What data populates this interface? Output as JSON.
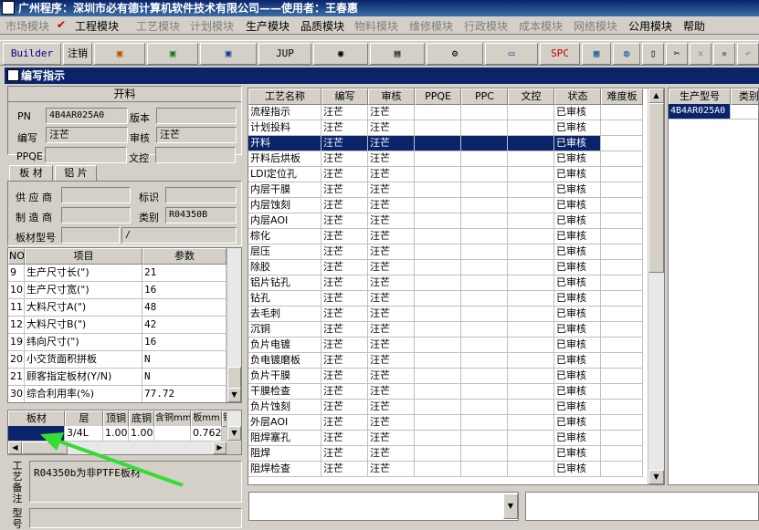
{
  "app_title": "广州程序：深圳市必有德计算机软件技术有限公司——使用者：王春惠",
  "menu": [
    {
      "label": "市场模块",
      "enabled": false
    },
    {
      "label": "工程模块",
      "enabled": true,
      "checked": true
    },
    {
      "label": "工艺模块",
      "enabled": false
    },
    {
      "label": "计划模块",
      "enabled": false
    },
    {
      "label": "生产模块",
      "enabled": true
    },
    {
      "label": "品质模块",
      "enabled": true
    },
    {
      "label": "物料模块",
      "enabled": false
    },
    {
      "label": "维修模块",
      "enabled": false
    },
    {
      "label": "行政模块",
      "enabled": false
    },
    {
      "label": "成本模块",
      "enabled": false
    },
    {
      "label": "网络模块",
      "enabled": false
    },
    {
      "label": "公用模块",
      "enabled": true
    },
    {
      "label": "帮助",
      "enabled": true
    }
  ],
  "toolbar": {
    "builder": "Builder",
    "logout": "注销",
    "jup": "JUP",
    "spc": "SPC"
  },
  "window_title": "编写指示",
  "process": {
    "title": "开料",
    "pn_label": "PN",
    "pn_value": "4B4AR025A0",
    "version_label": "版本",
    "version_value": "",
    "author_label": "编写",
    "author_value": "汪芒",
    "review_label": "审核",
    "review_value": "汪芒",
    "ppqe_label": "PPQE",
    "ppqe_value": "",
    "ctrl_label": "文控",
    "ctrl_value": ""
  },
  "tabs": [
    "板 材",
    "铝 片"
  ],
  "material": {
    "supplier_label": "供 应 商",
    "supplier_value": "",
    "mark_label": "标识",
    "mark_value": "",
    "maker_label": "制 造 商",
    "maker_value": "",
    "type_label": "类别",
    "type_value": "R04350B",
    "model_label": "板材型号",
    "model_value": "",
    "model_value2": "/"
  },
  "param_table": {
    "headers": [
      "NO",
      "项目",
      "参数"
    ],
    "rows": [
      [
        "9",
        "生产尺寸长(\")",
        "21"
      ],
      [
        "10",
        "生产尺寸宽(\")",
        "16"
      ],
      [
        "11",
        "大料尺寸A(\")",
        "48"
      ],
      [
        "12",
        "大料尺寸B(\")",
        "42"
      ],
      [
        "19",
        "纬向尺寸(\")",
        "16"
      ],
      [
        "20",
        "小交货面积拼板",
        "N"
      ],
      [
        "21",
        "顾客指定板材(Y/N)",
        "N"
      ],
      [
        "30",
        "综合利用率(%)",
        "77.72"
      ]
    ]
  },
  "board_table": {
    "headers": [
      "板材",
      "层",
      "顶铜",
      "底铜",
      "含铜mm",
      "板mm",
      "铜"
    ],
    "rows": [
      [
        "",
        "3/4L",
        "1.00",
        "1.00",
        "",
        "0.762",
        ""
      ]
    ]
  },
  "remark_label": "工艺备注",
  "remark_text": "R04350b为非PTFE板材",
  "model_label2": "型号",
  "process_table": {
    "headers": [
      "工艺名称",
      "编写",
      "审核",
      "PPQE",
      "PPC",
      "文控",
      "状态",
      "难度板"
    ],
    "selected_index": 2,
    "rows": [
      [
        "流程指示",
        "汪芒",
        "汪芒",
        "",
        "",
        "",
        "已审核",
        ""
      ],
      [
        "计划投料",
        "汪芒",
        "汪芒",
        "",
        "",
        "",
        "已审核",
        ""
      ],
      [
        "开料",
        "汪芒",
        "汪芒",
        "",
        "",
        "",
        "已审核",
        ""
      ],
      [
        "开料后烘板",
        "汪芒",
        "汪芒",
        "",
        "",
        "",
        "已审核",
        ""
      ],
      [
        "LDI定位孔",
        "汪芒",
        "汪芒",
        "",
        "",
        "",
        "已审核",
        ""
      ],
      [
        "内层干膜",
        "汪芒",
        "汪芒",
        "",
        "",
        "",
        "已审核",
        ""
      ],
      [
        "内层蚀刻",
        "汪芒",
        "汪芒",
        "",
        "",
        "",
        "已审核",
        ""
      ],
      [
        "内层AOI",
        "汪芒",
        "汪芒",
        "",
        "",
        "",
        "已审核",
        ""
      ],
      [
        "棕化",
        "汪芒",
        "汪芒",
        "",
        "",
        "",
        "已审核",
        ""
      ],
      [
        "层压",
        "汪芒",
        "汪芒",
        "",
        "",
        "",
        "已审核",
        ""
      ],
      [
        "除胶",
        "汪芒",
        "汪芒",
        "",
        "",
        "",
        "已审核",
        ""
      ],
      [
        "铝片钻孔",
        "汪芒",
        "汪芒",
        "",
        "",
        "",
        "已审核",
        ""
      ],
      [
        "钻孔",
        "汪芒",
        "汪芒",
        "",
        "",
        "",
        "已审核",
        ""
      ],
      [
        "去毛刺",
        "汪芒",
        "汪芒",
        "",
        "",
        "",
        "已审核",
        ""
      ],
      [
        "沉铜",
        "汪芒",
        "汪芒",
        "",
        "",
        "",
        "已审核",
        ""
      ],
      [
        "负片电镀",
        "汪芒",
        "汪芒",
        "",
        "",
        "",
        "已审核",
        ""
      ],
      [
        "负电镀磨板",
        "汪芒",
        "汪芒",
        "",
        "",
        "",
        "已审核",
        ""
      ],
      [
        "负片干膜",
        "汪芒",
        "汪芒",
        "",
        "",
        "",
        "已审核",
        ""
      ],
      [
        "干膜检查",
        "汪芒",
        "汪芒",
        "",
        "",
        "",
        "已审核",
        ""
      ],
      [
        "负片蚀刻",
        "汪芒",
        "汪芒",
        "",
        "",
        "",
        "已审核",
        ""
      ],
      [
        "外层AOI",
        "汪芒",
        "汪芒",
        "",
        "",
        "",
        "已审核",
        ""
      ],
      [
        "阻焊塞孔",
        "汪芒",
        "汪芒",
        "",
        "",
        "",
        "已审核",
        ""
      ],
      [
        "阻焊",
        "汪芒",
        "汪芒",
        "",
        "",
        "",
        "已审核",
        ""
      ],
      [
        "阻焊检查",
        "汪芒",
        "汪芒",
        "",
        "",
        "",
        "已审核",
        ""
      ]
    ]
  },
  "model_table": {
    "headers": [
      "生产型号",
      "类别"
    ],
    "rows": [
      [
        "4B4AR025A0",
        ""
      ]
    ]
  },
  "colors": {
    "title": "#0a246a",
    "arrow": "#33dd33"
  }
}
